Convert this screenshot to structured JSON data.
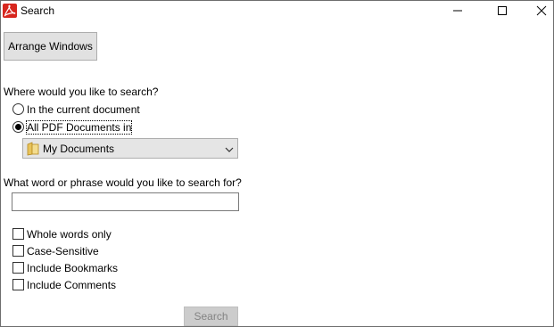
{
  "window": {
    "title": "Search"
  },
  "buttons": {
    "arrange": "Arrange Windows",
    "search": "Search"
  },
  "scope": {
    "question": "Where would you like to search?",
    "options": [
      {
        "label": "In the current document",
        "selected": false
      },
      {
        "label": "All PDF Documents in",
        "selected": true
      }
    ],
    "location": "My Documents"
  },
  "phrase": {
    "question": "What word or phrase would you like to search for?",
    "value": ""
  },
  "options": [
    {
      "label": "Whole words only",
      "checked": false
    },
    {
      "label": "Case-Sensitive",
      "checked": false
    },
    {
      "label": "Include Bookmarks",
      "checked": false
    },
    {
      "label": "Include Comments",
      "checked": false
    }
  ],
  "colors": {
    "acrobat_red": "#d7261e",
    "folder_yellow": "#e8c35a"
  },
  "icons": [
    "acrobat-logo-icon",
    "minimize-icon",
    "maximize-icon",
    "close-icon",
    "folder-icon",
    "chevron-down-icon"
  ]
}
